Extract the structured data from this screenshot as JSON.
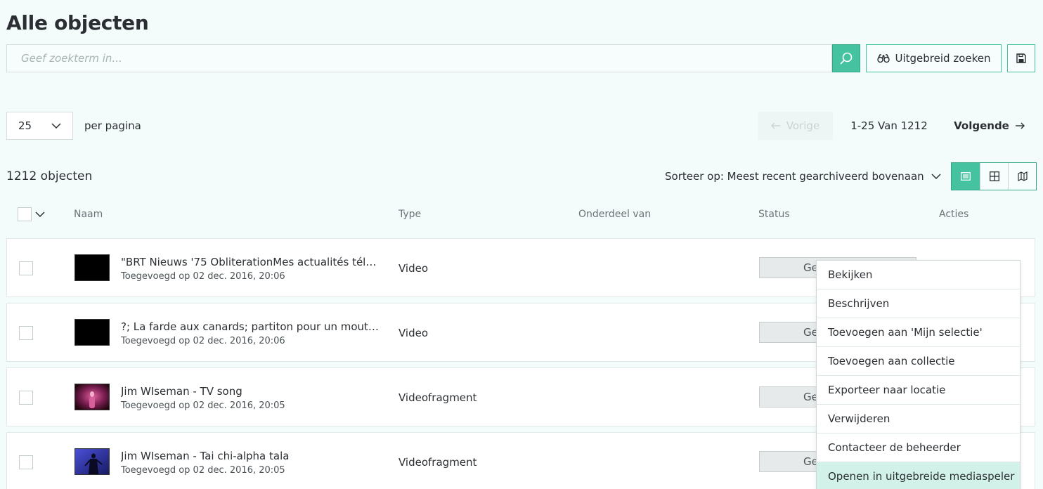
{
  "page": {
    "title": "Alle objecten"
  },
  "search": {
    "placeholder": "Geef zoekterm in...",
    "advanced_label": "Uitgebreid zoeken"
  },
  "pagination": {
    "per_page_value": "25",
    "per_page_label": "per pagina",
    "prev_label": "Vorige",
    "range_label": "1-25 Van 1212",
    "next_label": "Volgende"
  },
  "listing": {
    "count_label": "1212 objecten",
    "sort_label": "Sorteer op: Meest recent gearchiveerd bovenaan"
  },
  "table": {
    "headers": {
      "name": "Naam",
      "type": "Type",
      "part_of": "Onderdeel van",
      "status": "Status",
      "actions": "Acties"
    },
    "rows": [
      {
        "name": "\"BRT Nieuws '75 ObliterationMes actualités télé...",
        "added": "Toegevoegd op 02 dec. 2016, 20:06",
        "type": "Video",
        "status": "Ge",
        "thumb": "black"
      },
      {
        "name": "?; La farde aux canards; partiton pour un mouton...",
        "added": "Toegevoegd op 02 dec. 2016, 20:06",
        "type": "Video",
        "status": "Ge",
        "thumb": "black"
      },
      {
        "name": "Jim WIseman - TV song",
        "added": "Toegevoegd op 02 dec. 2016, 20:05",
        "type": "Videofragment",
        "status": "Ge",
        "thumb": "pink"
      },
      {
        "name": "Jim WIseman - Tai chi-alpha tala",
        "added": "Toegevoegd op 02 dec. 2016, 20:05",
        "type": "Videofragment",
        "status": "Ge",
        "thumb": "blue"
      }
    ]
  },
  "context_menu": {
    "items": [
      "Bekijken",
      "Beschrijven",
      "Toevoegen aan 'Mijn selectie'",
      "Toevoegen aan collectie",
      "Exporteer naar locatie",
      "Verwijderen",
      "Contacteer de beheerder",
      "Openen in uitgebreide mediaspeler"
    ]
  },
  "colors": {
    "accent": "#45c2a0",
    "page_bg": "#f4fbfb",
    "menu_active_bg": "#d2f1e8"
  }
}
